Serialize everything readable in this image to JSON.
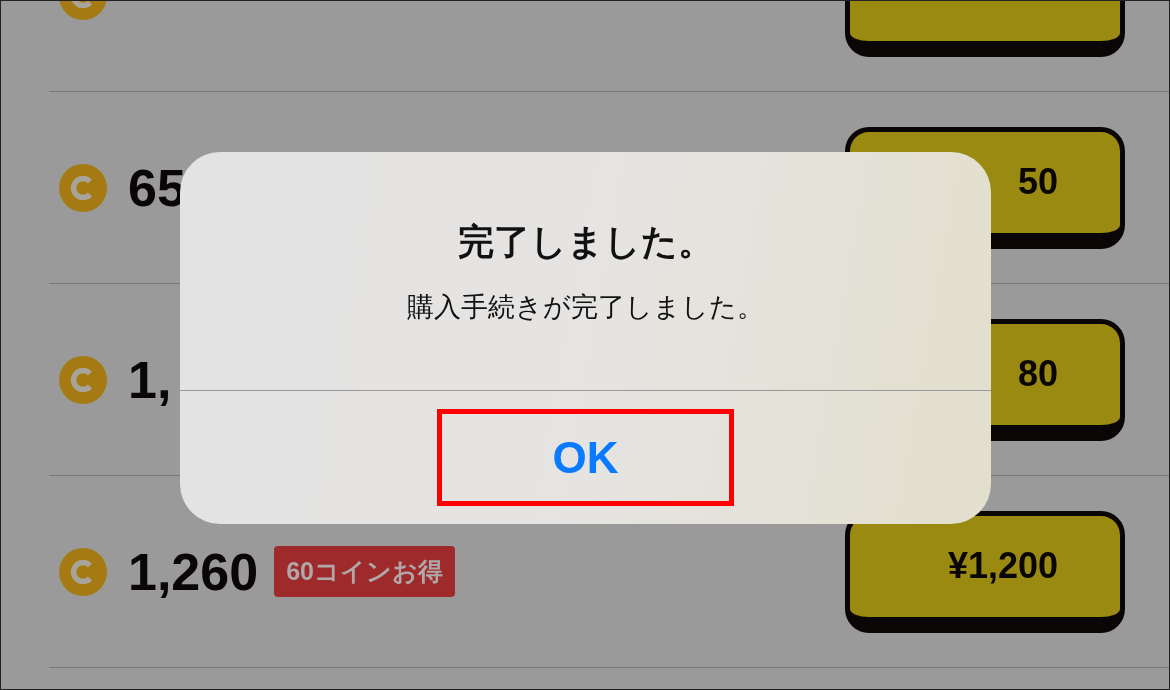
{
  "rows": [
    {},
    {
      "amount": "65",
      "price": "50"
    },
    {
      "amount": "1,",
      "price": "80"
    },
    {
      "amount": "1,260",
      "badge": "60コインお得",
      "price": "¥1,200"
    }
  ],
  "alert": {
    "title": "完了しました。",
    "message": "購入手続きが完了しました。",
    "ok_button": {
      "label": "OK",
      "highlighted": true
    }
  }
}
